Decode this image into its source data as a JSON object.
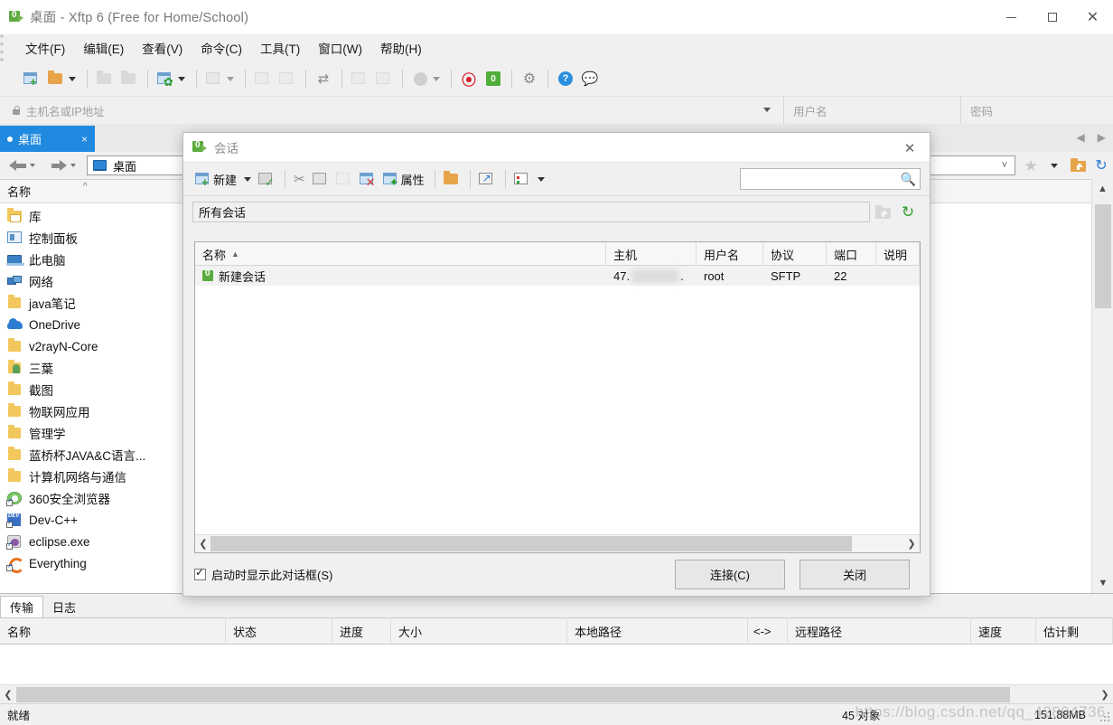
{
  "window": {
    "title": "桌面 - Xftp 6 (Free for Home/School)",
    "app_icon": "xftp-icon",
    "minimize": "—",
    "maximize": "□",
    "close": "✕"
  },
  "menubar": {
    "items": [
      {
        "label": "文件(F)"
      },
      {
        "label": "编辑(E)"
      },
      {
        "label": "查看(V)"
      },
      {
        "label": "命令(C)"
      },
      {
        "label": "工具(T)"
      },
      {
        "label": "窗口(W)"
      },
      {
        "label": "帮助(H)"
      }
    ]
  },
  "connect_bar": {
    "host_placeholder": "主机名或IP地址",
    "user_placeholder": "用户名",
    "password_placeholder": "密码"
  },
  "tabs": {
    "items": [
      {
        "label": "桌面",
        "close": "×"
      }
    ]
  },
  "address_bar": {
    "path": "桌面"
  },
  "file_list": {
    "column_header": "名称",
    "sort_indicator": "^",
    "items": [
      {
        "label": "库",
        "icon": "library-icon"
      },
      {
        "label": "控制面板",
        "icon": "control-panel-icon"
      },
      {
        "label": "此电脑",
        "icon": "this-pc-icon"
      },
      {
        "label": "网络",
        "icon": "network-icon"
      },
      {
        "label": "java笔记",
        "icon": "folder-icon"
      },
      {
        "label": "OneDrive",
        "icon": "onedrive-icon"
      },
      {
        "label": "v2rayN-Core",
        "icon": "folder-icon"
      },
      {
        "label": "三葉",
        "icon": "user-folder-icon"
      },
      {
        "label": "截图",
        "icon": "folder-icon"
      },
      {
        "label": "物联网应用",
        "icon": "folder-icon"
      },
      {
        "label": "管理学",
        "icon": "folder-icon"
      },
      {
        "label": "蓝桥杯JAVA&C语言...",
        "icon": "folder-icon"
      },
      {
        "label": "计算机网络与通信",
        "icon": "folder-icon"
      },
      {
        "label": "360安全浏览器",
        "icon": "browser-360-icon"
      },
      {
        "label": "Dev-C++",
        "icon": "dev-cpp-icon"
      },
      {
        "label": "eclipse.exe",
        "icon": "eclipse-icon"
      },
      {
        "label": "Everything",
        "icon": "everything-icon"
      }
    ]
  },
  "bottom_panel": {
    "tabs": [
      {
        "label": "传输",
        "active": true
      },
      {
        "label": "日志",
        "active": false
      }
    ],
    "columns": [
      "名称",
      "状态",
      "进度",
      "大小",
      "本地路径",
      "<->",
      "远程路径",
      "速度",
      "估计剩"
    ],
    "rows": []
  },
  "status_bar": {
    "state": "就绪",
    "object_count": "45 对象",
    "total_size": "151.88MB"
  },
  "watermark": "https://blog.csdn.net/qq_42804736",
  "dialog": {
    "title": "会话",
    "close": "✕",
    "toolbar": {
      "new_label": "新建",
      "properties_label": "属性",
      "dropdown_caret": "▼",
      "search_value": "",
      "icons": [
        "new-session-icon",
        "dropdown-caret-icon",
        "save-as-icon",
        "cut-icon",
        "copy-icon",
        "paste-icon",
        "delete-icon",
        "properties-icon",
        "open-folder-icon",
        "shortcut-icon",
        "view-icon"
      ]
    },
    "path_value": "所有会话",
    "list": {
      "columns": [
        {
          "label": "名称",
          "sort": "▲"
        },
        {
          "label": "主机"
        },
        {
          "label": "用户名"
        },
        {
          "label": "协议"
        },
        {
          "label": "端口"
        },
        {
          "label": "说明"
        }
      ],
      "rows": [
        {
          "name": "新建会话",
          "host_prefix": "47.",
          "host_suffix": ".",
          "host_redacted": true,
          "user": "root",
          "protocol": "SFTP",
          "port": "22",
          "description": ""
        }
      ]
    },
    "show_on_startup_label": "启动时显示此对话框(S)",
    "show_on_startup_checked": true,
    "connect_label": "连接(C)",
    "close_label": "关闭"
  },
  "colors": {
    "tab_active": "#1f8ae0",
    "brand_green": "#5cab3f",
    "folder_yellow": "#f2c75c",
    "accent_blue": "#2b7cd3"
  }
}
